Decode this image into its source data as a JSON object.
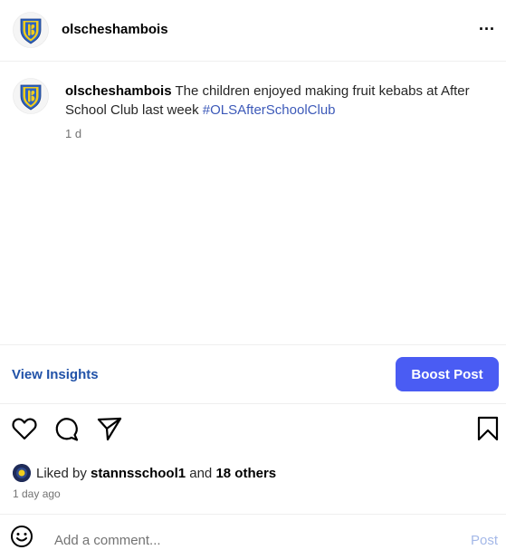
{
  "header": {
    "username": "olscheshambois",
    "more_label": "..."
  },
  "caption": {
    "username": "olscheshambois",
    "text": "The children enjoyed making fruit kebabs at After School Club last week",
    "hashtag": "#OLSAfterSchoolClub",
    "time": "1 d"
  },
  "insights": {
    "view_label": "View Insights",
    "boost_label": "Boost Post"
  },
  "actions": {
    "icons": [
      "heart-icon",
      "comment-icon",
      "share-icon",
      "bookmark-icon"
    ]
  },
  "likes": {
    "prefix": "Liked by",
    "user": "stannsschool1",
    "joiner": "and",
    "others": "18 others",
    "time": "1 day ago"
  },
  "comment": {
    "placeholder": "Add a comment...",
    "post_label": "Post"
  },
  "colors": {
    "accent": "#4a5cf3",
    "link": "#2152a8",
    "hashtag": "#3d5ab9",
    "muted": "#737373",
    "post_disabled": "#a4b8e8",
    "crest_yellow": "#f2cd1b",
    "crest_blue": "#2d63c2"
  }
}
